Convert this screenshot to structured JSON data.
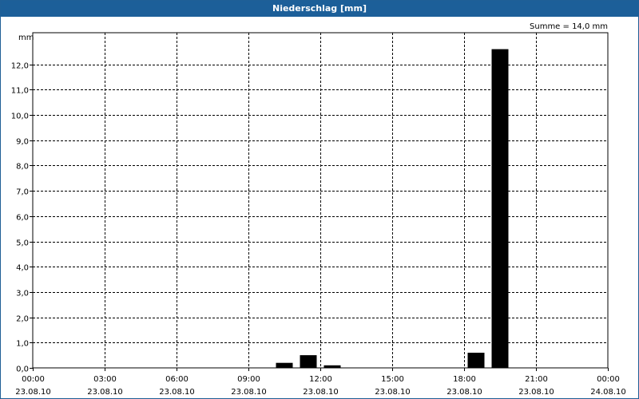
{
  "window": {
    "title": "Niederschlag [mm]"
  },
  "chart_data": {
    "type": "bar",
    "title": "Niederschlag [mm]",
    "unit_label": "mm",
    "sum_label": "Summe = 14,0 mm",
    "x_ticks": [
      {
        "time": "00:00",
        "date": "23.08.10"
      },
      {
        "time": "03:00",
        "date": "23.08.10"
      },
      {
        "time": "06:00",
        "date": "23.08.10"
      },
      {
        "time": "09:00",
        "date": "23.08.10"
      },
      {
        "time": "12:00",
        "date": "23.08.10"
      },
      {
        "time": "15:00",
        "date": "23.08.10"
      },
      {
        "time": "18:00",
        "date": "23.08.10"
      },
      {
        "time": "21:00",
        "date": "23.08.10"
      },
      {
        "time": "00:00",
        "date": "24.08.10"
      }
    ],
    "y_ticks": [
      "0,0",
      "1,0",
      "2,0",
      "3,0",
      "4,0",
      "5,0",
      "6,0",
      "7,0",
      "8,0",
      "9,0",
      "10,0",
      "11,0",
      "12,0"
    ],
    "ylim": [
      0,
      13
    ],
    "xlim_hours": [
      0,
      24
    ],
    "grid": true,
    "bar_color": "#000000",
    "bars": [
      {
        "hour": 10,
        "value": 0.2
      },
      {
        "hour": 11,
        "value": 0.5
      },
      {
        "hour": 12,
        "value": 0.1
      },
      {
        "hour": 18,
        "value": 0.6
      },
      {
        "hour": 19,
        "value": 12.6
      }
    ]
  }
}
